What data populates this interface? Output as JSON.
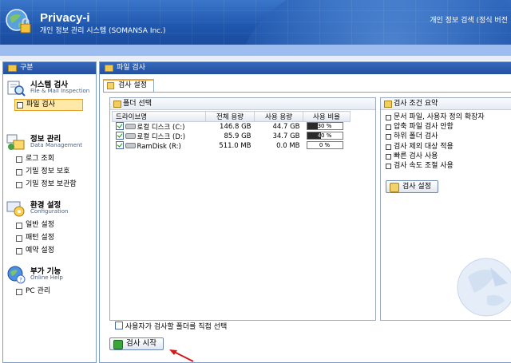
{
  "header": {
    "title": "Privacy-i",
    "subtitle": "개인 정보 관리 시스템 (SOMANSA Inc.)",
    "version": "개인 정보 검색 (정식 버전"
  },
  "sidebar": {
    "title": "구분",
    "sections": [
      {
        "title": "시스템 검사",
        "subtitle": "File & Mail Inspection",
        "icon": "system-scan-icon",
        "items": [
          {
            "label": "파일 검사",
            "active": true
          }
        ]
      },
      {
        "title": "정보 관리",
        "subtitle": "Data Management",
        "icon": "data-management-icon",
        "items": [
          {
            "label": "로그 조회"
          },
          {
            "label": "기밀 정보 보호"
          },
          {
            "label": "기밀 정보 보관함"
          }
        ]
      },
      {
        "title": "환경 설정",
        "subtitle": "Configuration",
        "icon": "configuration-icon",
        "items": [
          {
            "label": "일반 설정"
          },
          {
            "label": "패턴 설정"
          },
          {
            "label": "예약 설정"
          }
        ]
      },
      {
        "title": "부가 기능",
        "subtitle": "Online Help",
        "icon": "help-icon",
        "items": [
          {
            "label": "PC 관리"
          }
        ]
      }
    ]
  },
  "main": {
    "title": "파일 검사",
    "tab": "검사 설정",
    "folder_panel": {
      "title": "폴더 선택",
      "columns": [
        "드라이브명",
        "전체 용량",
        "사용 용량",
        "사용 비율"
      ],
      "rows": [
        {
          "name": "로컬 디스크 (C:)",
          "total": "146.8 GB",
          "used": "44.7 GB",
          "ratio": "30 %",
          "ratio_value": 0.3,
          "checked": true
        },
        {
          "name": "로컬 디스크 (D:)",
          "total": "85.9 GB",
          "used": "34.7 GB",
          "ratio": "40 %",
          "ratio_value": 0.4,
          "checked": true
        },
        {
          "name": "RamDisk (R:)",
          "total": "511.0 MB",
          "used": "0.0 MB",
          "ratio": "0 %",
          "ratio_value": 0.0,
          "checked": true
        }
      ],
      "custom_folder_label": "사용자가 검사할 폴더를 직접 선택"
    },
    "summary_panel": {
      "title": "검사 조건 요약",
      "items": [
        "문서 파일, 사용자 정의 확장자",
        "압축 파일 검사 안함",
        "하위 폴더 검사",
        "검사 제외 대상 적용",
        "빠른 검사 사용",
        "검사 속도 조절 사용"
      ],
      "settings_button": "검사 설정"
    },
    "start_button": "검사 시작"
  },
  "colors": {
    "header_blue": "#1f56ad",
    "accent_orange": "#f0a33a",
    "annotation_red": "#d21a1a"
  }
}
